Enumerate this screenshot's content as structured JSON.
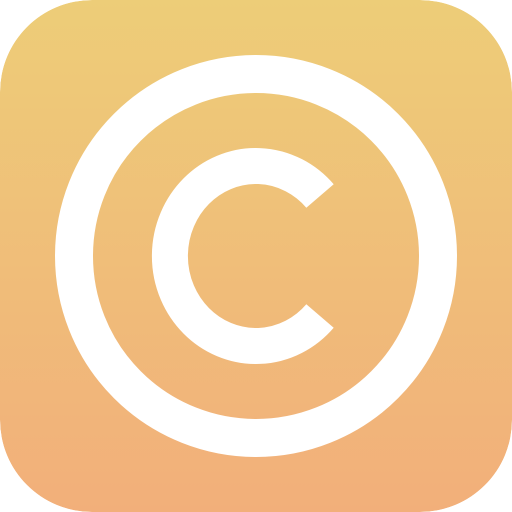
{
  "app_icon": {
    "icon": "copyright-icon",
    "symbol": "©",
    "colors": {
      "gradient_top": "#EDCD78",
      "gradient_bottom": "#F2AF7A",
      "glyph": "#FFFFFF"
    }
  }
}
